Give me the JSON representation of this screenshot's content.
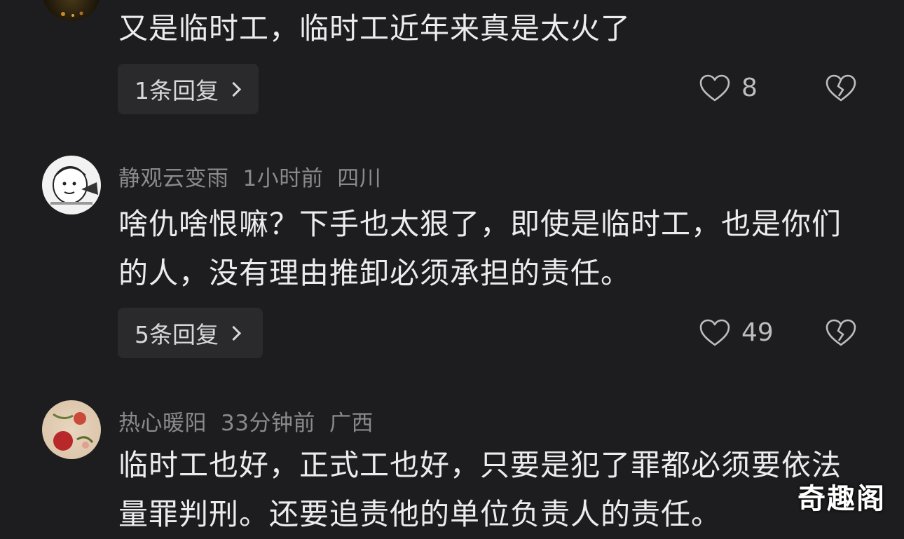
{
  "comments": [
    {
      "username": "",
      "time": "",
      "location": "",
      "text": "又是临时工，临时工近年来真是太火了",
      "reply_label": "1条回复",
      "likes": "8"
    },
    {
      "username": "静观云变雨",
      "time": "1小时前",
      "location": "四川",
      "text": "啥仇啥恨嘛？下手也太狠了，即使是临时工，也是你们的人，没有理由推卸必须承担的责任。",
      "reply_label": "5条回复",
      "likes": "49"
    },
    {
      "username": "热心暖阳",
      "time": "33分钟前",
      "location": "广西",
      "text": "临时工也好，正式工也好，只要是犯了罪都必须要依法量罪判刑。还要追责他的单位负责人的责任。",
      "reply_label": "",
      "likes": ""
    }
  ],
  "watermark": "奇趣阁",
  "icons": {
    "like": "heart-outline-icon",
    "dislike": "broken-heart-icon",
    "reply_chevron": "chevron-right-icon"
  },
  "colors": {
    "background": "#1d1d1f",
    "text": "#ececec",
    "meta": "#8a8a8e",
    "button_bg": "#2a2a2d"
  }
}
